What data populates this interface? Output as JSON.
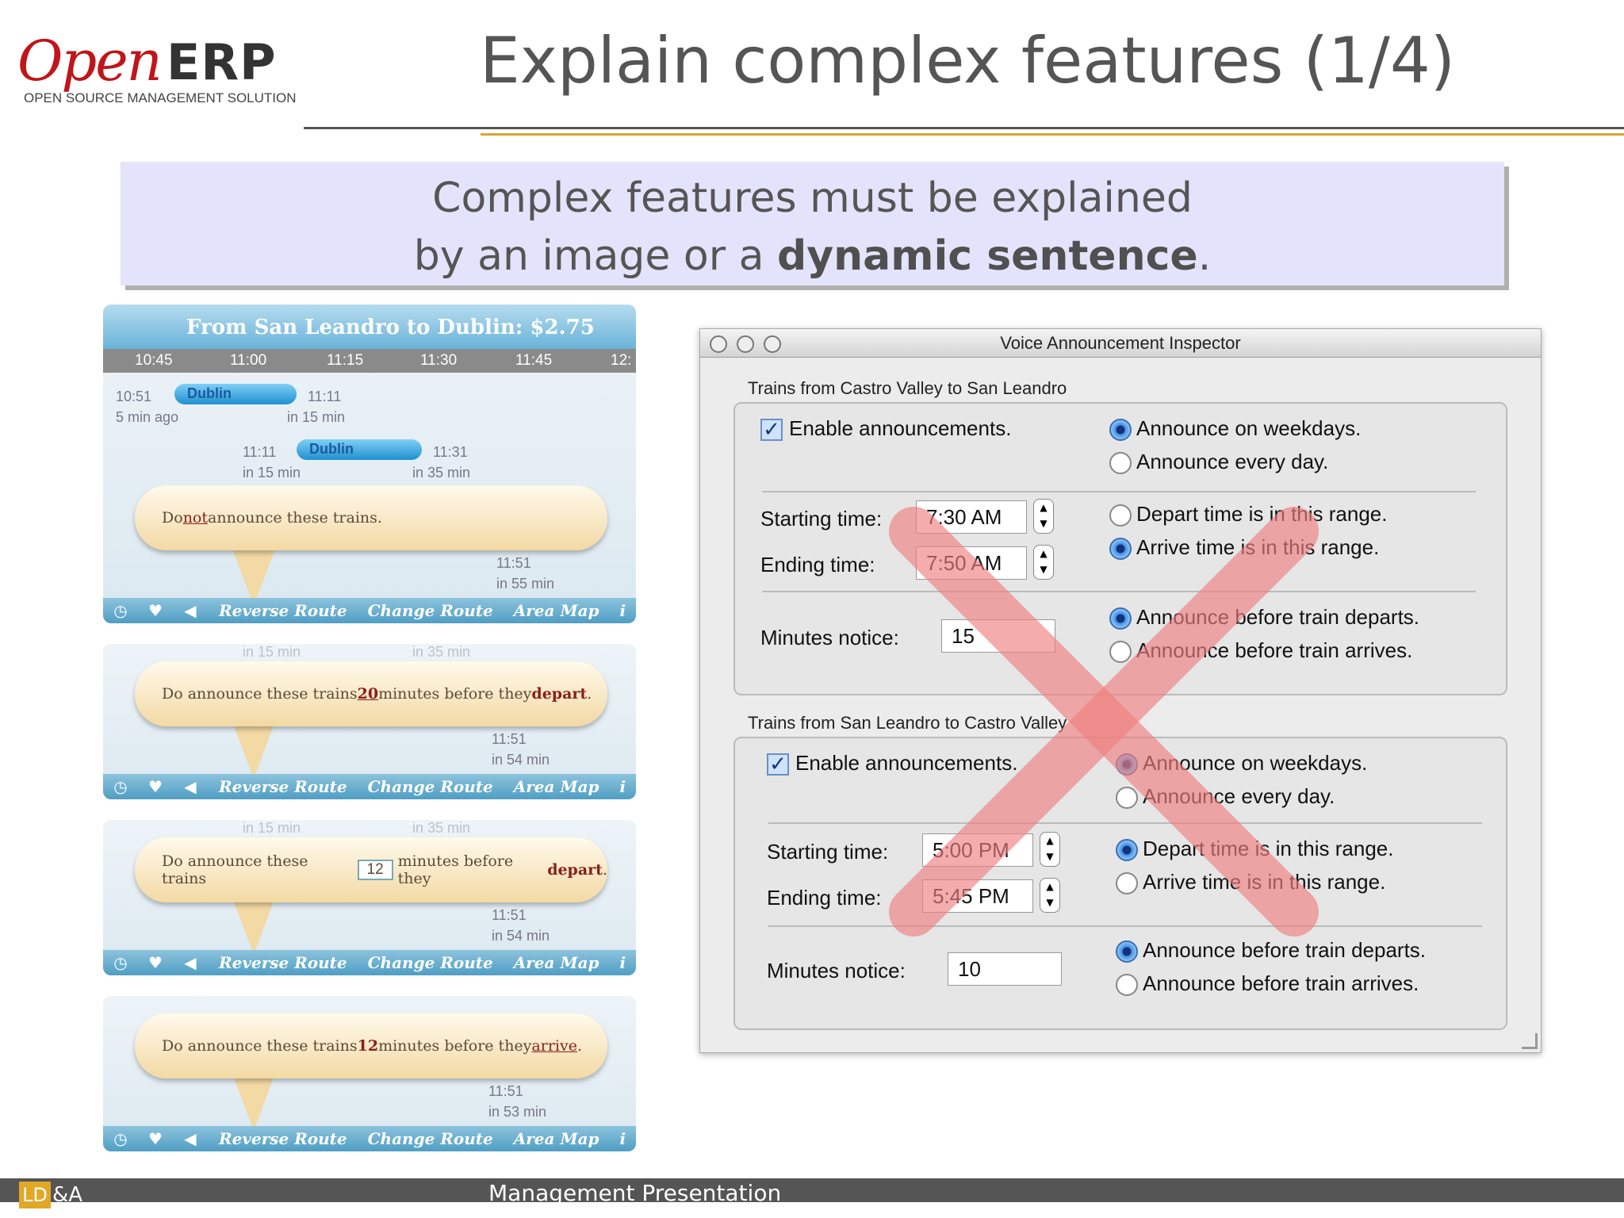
{
  "header": {
    "logo_open": "Open",
    "logo_erp": "ERP",
    "logo_tagline": "OPEN SOURCE MANAGEMENT SOLUTION",
    "title": "Explain complex features (1/4)"
  },
  "callout": {
    "line1": "Complex features must be explained",
    "line2_prefix": "by an image or a ",
    "line2_bold": "dynamic sentence",
    "line2_suffix": "."
  },
  "widget": {
    "route_title": "From San Leandro to Dublin: $2.75",
    "times": [
      "10:45",
      "11:00",
      "11:15",
      "11:30",
      "11:45",
      "12:"
    ],
    "train1": {
      "dep": "10:51",
      "ago": "5 min ago",
      "dest": "Dublin",
      "arr": "11:11",
      "in": "in 15 min"
    },
    "train2": {
      "dep": "11:11",
      "in_dep": "in 15 min",
      "dest": "Dublin",
      "arr": "11:31",
      "in_arr": "in 35 min"
    },
    "bubble1": {
      "pre": "Do ",
      "link": "not",
      "post": " announce these trains."
    },
    "bubble2": {
      "pre": "Do announce these trains ",
      "num": "20",
      "mid": " minutes before they ",
      "end": "depart",
      "dot": "."
    },
    "bubble3": {
      "pre": "Do announce these trains",
      "num": "12",
      "mid": "minutes before they ",
      "end": "depart",
      "dot": "."
    },
    "bubble4": {
      "pre": "Do announce these trains ",
      "num": "12",
      "mid": " minutes before they ",
      "end": "arrive",
      "dot": "."
    },
    "tail_trains": [
      {
        "t": "11:51",
        "in": "in 55 min"
      },
      {
        "t": "11:51",
        "in": "in 54 min"
      },
      {
        "t": "11:51",
        "in": "in 54 min"
      },
      {
        "t": "11:51",
        "in": "in 53 min"
      }
    ],
    "faded": [
      "in 15 min",
      "in 35 min"
    ],
    "bar": {
      "reverse": "Reverse Route",
      "change": "Change Route",
      "map": "Area Map",
      "info": "i"
    }
  },
  "inspector": {
    "title": "Voice Announcement Inspector",
    "group1": {
      "title": "Trains from Castro Valley to San Leandro",
      "enable": "Enable announcements.",
      "weekdays": "Announce on weekdays.",
      "everyday": "Announce every day.",
      "start_label": "Starting time:",
      "start": "7:30 AM",
      "end_label": "Ending time:",
      "end": "7:50 AM",
      "depart_range": "Depart time is in this range.",
      "arrive_range": "Arrive time is in this range.",
      "notice_label": "Minutes notice:",
      "notice": "15",
      "before_depart": "Announce before train departs.",
      "before_arrive": "Announce before train arrives."
    },
    "group2": {
      "title": "Trains from San Leandro to Castro Valley",
      "enable": "Enable announcements.",
      "weekdays": "Announce on weekdays.",
      "everyday": "Announce every day.",
      "start_label": "Starting time:",
      "start": "5:00 PM",
      "end_label": "Ending time:",
      "end": "5:45 PM",
      "depart_range": "Depart time is in this range.",
      "arrive_range": "Arrive time is in this range.",
      "notice_label": "Minutes notice:",
      "notice": "10",
      "before_depart": "Announce before train departs.",
      "before_arrive": "Announce before train arrives."
    }
  },
  "footer": {
    "ld": "LD",
    "amp": "&A",
    "text": "Management Presentation"
  },
  "colors": {
    "callout_bg": "#e3e3fb",
    "accent_gold": "#d9a531",
    "cross": "#f08080"
  }
}
